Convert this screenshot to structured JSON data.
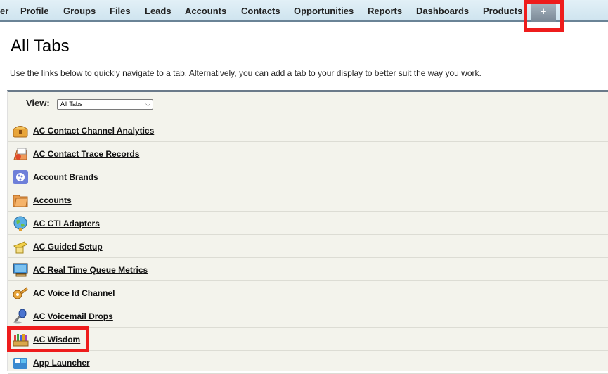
{
  "tabbar": {
    "tabs": [
      {
        "label": "er"
      },
      {
        "label": "Profile"
      },
      {
        "label": "Groups"
      },
      {
        "label": "Files"
      },
      {
        "label": "Leads"
      },
      {
        "label": "Accounts"
      },
      {
        "label": "Contacts"
      },
      {
        "label": "Opportunities"
      },
      {
        "label": "Reports"
      },
      {
        "label": "Dashboards"
      },
      {
        "label": "Products"
      }
    ],
    "plus_label": "+"
  },
  "header": {
    "title": "All Tabs",
    "intro_before": "Use the links below to quickly navigate to a tab. Alternatively, you can ",
    "intro_link": "add a tab",
    "intro_after": " to your display to better suit the way you work."
  },
  "view": {
    "label": "View:",
    "selected": "All Tabs"
  },
  "tab_list": [
    {
      "label": "AC Contact Channel Analytics",
      "icon": "treasure-chest-icon"
    },
    {
      "label": "AC Contact Trace Records",
      "icon": "records-icon"
    },
    {
      "label": "Account Brands",
      "icon": "palette-icon"
    },
    {
      "label": "Accounts",
      "icon": "folder-icon"
    },
    {
      "label": "AC CTI Adapters",
      "icon": "globe-icon"
    },
    {
      "label": "AC Guided Setup",
      "icon": "hand-pointer-icon"
    },
    {
      "label": "AC Real Time Queue Metrics",
      "icon": "monitor-icon"
    },
    {
      "label": "AC Voice Id Channel",
      "icon": "key-icon"
    },
    {
      "label": "AC Voicemail Drops",
      "icon": "microphone-icon"
    },
    {
      "label": "AC Wisdom",
      "icon": "crayons-icon"
    },
    {
      "label": "App Launcher",
      "icon": "app-launcher-icon"
    }
  ],
  "colors": {
    "highlight": "#ee1c1c",
    "tabbar_bg": "#cfe4ef",
    "panel_bg": "#f3f3ec"
  }
}
